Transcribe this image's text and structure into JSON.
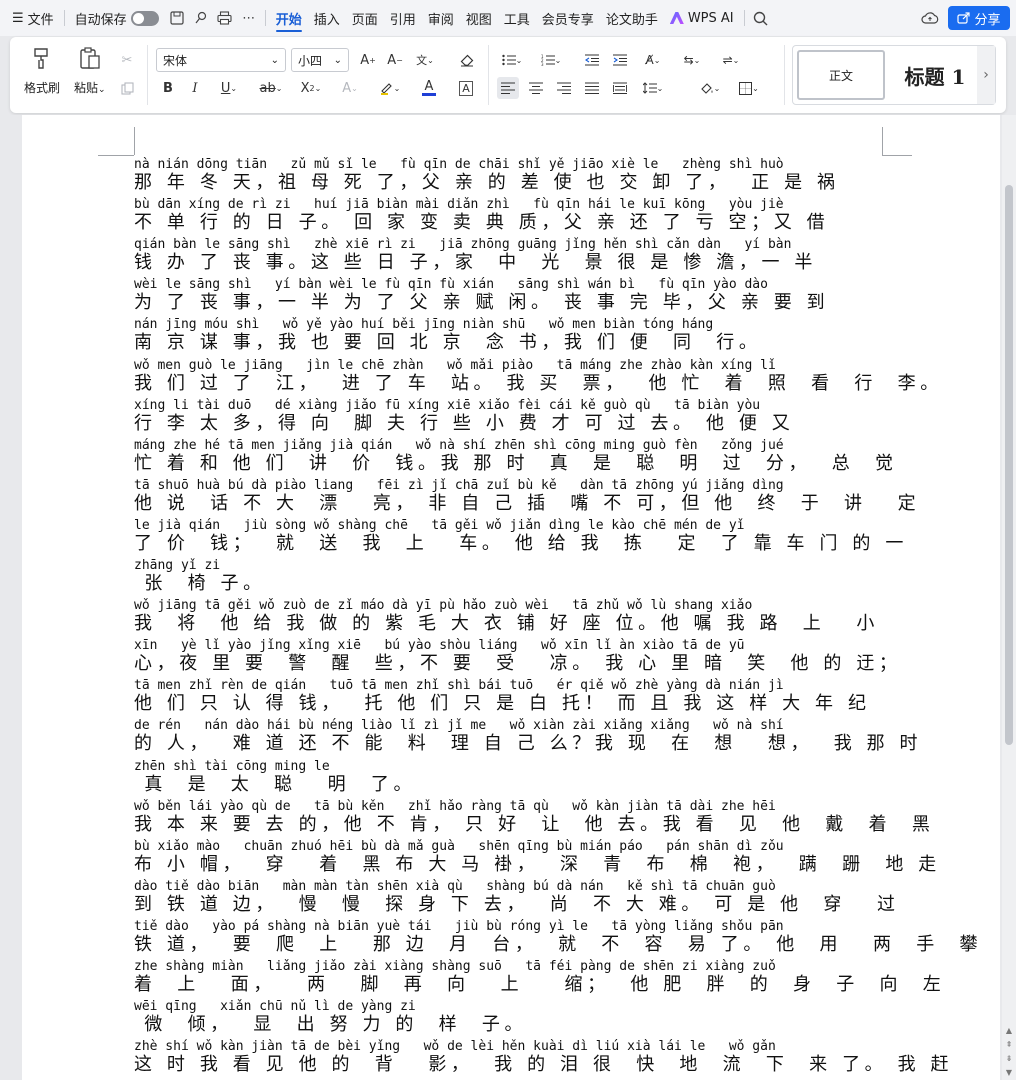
{
  "menubar": {
    "file_label": "文件",
    "autosave_label": "自动保存",
    "tabs": [
      "开始",
      "插入",
      "页面",
      "引用",
      "审阅",
      "视图",
      "工具",
      "会员专享",
      "论文助手"
    ],
    "active_tab": "开始",
    "wps_ai_label": "WPS AI",
    "share_label": "分享"
  },
  "ribbon": {
    "format_painter_label": "格式刷",
    "paste_label": "粘贴",
    "font_name": "宋体",
    "font_size": "小四",
    "styles": {
      "normal_label": "正文",
      "heading1_label": "标题 1"
    }
  },
  "colors": {
    "accent": "#1a5fd6",
    "share_button": "#1a6cf0",
    "font_color_underline": "#1f3fd6"
  },
  "document": {
    "lines": [
      {
        "py": "nà nián dōng tiān   zǔ mǔ sǐ le   fù qīn de chāi shǐ yě jiāo xiè le   zhèng shì huò",
        "hz": "那 年 冬 天，祖 母 死 了，父 亲 的 差 使 也 交 卸 了，  正 是 祸"
      },
      {
        "py": "bù dān xíng de rì zi   huí jiā biàn mài diǎn zhì   fù qīn hái le kuī kōng   yòu jiè",
        "hz": "不 单 行 的 日 子。 回 家 变 卖 典 质，父 亲 还 了 亏 空；又 借"
      },
      {
        "py": "qián bàn le sāng shì   zhè xiē rì zi   jiā zhōng guāng jǐng hěn shì cǎn dàn   yí bàn",
        "hz": "钱 办 了 丧 事。这 些 日 子，家  中  光  景 很 是 惨 澹，一 半"
      },
      {
        "py": "wèi le sāng shì   yí bàn wèi le fù qīn fù xián   sāng shì wán bì   fù qīn yào dào",
        "hz": "为 了 丧 事，一 半 为 了 父 亲 赋 闲。 丧 事 完 毕，父 亲 要 到"
      },
      {
        "py": "nán jīng móu shì   wǒ yě yào huí běi jīng niàn shū   wǒ men biàn tóng háng",
        "hz": "南 京 谋 事，我 也 要 回 北 京  念 书，我 们 便  同  行。"
      },
      {
        "py": "wǒ men guò le jiāng   jìn le chē zhàn   wǒ mǎi piào   tā máng zhe zhào kàn xíng lǐ",
        "hz": "我 们 过 了  江，  进 了 车  站。 我 买  票，  他 忙  着  照  看  行  李。"
      },
      {
        "py": "xíng li tài duō   dé xiàng jiǎo fū xíng xiē xiǎo fèi cái kě guò qù   tā biàn yòu",
        "hz": "行 李 太 多，得 向  脚 夫 行 些 小 费 才 可 过 去。 他 便 又"
      },
      {
        "py": "máng zhe hé tā men jiǎng jià qián   wǒ nà shí zhēn shì cōng ming guò fèn   zǒng jué",
        "hz": "忙 着 和 他 们  讲  价  钱。我 那 时  真  是  聪  明  过  分，  总  觉"
      },
      {
        "py": "tā shuō huà bú dà piào liang   fēi zì jǐ chā zuǐ bù kě   dàn tā zhōng yú jiǎng dìng",
        "hz": "他 说  话 不 大  漂   亮， 非 自 己 插  嘴 不 可，但 他  终  于  讲   定"
      },
      {
        "py": "le jià qián   jiù sòng wǒ shàng chē   tā gěi wǒ jiǎn dìng le kào chē mén de yǐ",
        "hz": "了 价  钱；  就  送  我  上   车。 他 给 我  拣   定  了 靠 车 门 的 一"
      },
      {
        "py": "zhāng yǐ zi",
        "hz": " 张  椅 子。"
      },
      {
        "py": "wǒ jiāng tā gěi wǒ zuò de zǐ máo dà yī pù hǎo zuò wèi   tā zhǔ wǒ lù shang xiǎo",
        "hz": "我  将  他 给 我 做 的 紫 毛 大 衣 铺 好 座 位。他 嘱 我 路  上   小"
      },
      {
        "py": "xīn   yè lǐ yào jǐng xǐng xiē   bú yào shòu liáng   wǒ xīn lǐ àn xiào tā de yū",
        "hz": "心，夜 里 要  警  醒  些，不 要  受   凉。 我 心 里 暗  笑  他 的 迂；"
      },
      {
        "py": "tā men zhǐ rèn de qián   tuō tā men zhǐ shì bái tuō   ér qiě wǒ zhè yàng dà nián jì",
        "hz": "他 们 只 认 得 钱，  托 他 们 只 是 白 托！ 而 且 我 这 样 大 年 纪"
      },
      {
        "py": "de rén   nán dào hái bù néng liào lǐ zì jǐ me   wǒ xiàn zài xiǎng xiǎng   wǒ nà shí",
        "hz": "的 人，  难 道 还 不 能  料  理 自 己 么？我 现  在  想   想，  我 那 时"
      },
      {
        "py": "zhēn shì tài cōng ming le",
        "hz": " 真  是  太  聪   明  了。"
      },
      {
        "py": "wǒ běn lái yào qù de   tā bù kěn   zhǐ hǎo ràng tā qù   wǒ kàn jiàn tā dài zhe hēi",
        "hz": "我 本 来 要 去 的，他 不 肯， 只 好  让  他 去。我 看  见  他  戴  着  黑"
      },
      {
        "py": "bù xiǎo mào   chuān zhuó hēi bù dà mǎ guà   shēn qīng bù mián páo   pán shān dì zǒu",
        "hz": "布 小 帽，  穿   着  黑 布 大 马 褂，  深  青  布  棉  袍，  蹒  跚  地 走"
      },
      {
        "py": "dào tiě dào biān   màn màn tàn shēn xià qù   shàng bú dà nán   kě shì tā chuān guò",
        "hz": "到 铁 道 边，  慢  慢  探 身 下 去，  尚  不 大 难。 可 是 他  穿   过"
      },
      {
        "py": "tiě dào   yào pá shàng nà biān yuè tái   jiù bù róng yì le   tā yòng liǎng shǒu pān",
        "hz": "铁 道，  要  爬  上   那 边  月  台，  就  不  容  易 了。 他  用   两  手  攀"
      },
      {
        "py": "zhe shàng miàn   liǎng jiǎo zài xiàng shàng suō   tā féi pàng de shēn zi xiàng zuǒ",
        "hz": "着  上   面，   两   脚  再  向   上    缩；  他 肥  胖  的  身  子  向  左"
      },
      {
        "py": "wēi qīng   xiǎn chū nǔ lì de yàng zi",
        "hz": " 微  倾，  显  出 努 力 的  样  子。"
      },
      {
        "py": "zhè shí wǒ kàn jiàn tā de bèi yǐng   wǒ de lèi hěn kuài dì liú xià lái le   wǒ gǎn",
        "hz": "这 时 我 看 见 他 的  背   影，  我 的 泪 很  快  地  流  下  来 了。 我 赶"
      }
    ]
  }
}
